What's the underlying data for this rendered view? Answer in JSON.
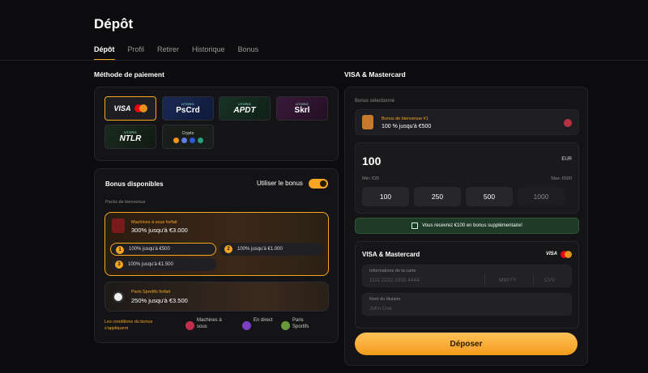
{
  "title": "Dépôt",
  "tabs": [
    "Dépôt",
    "Profil",
    "Retirer",
    "Historique",
    "Bonus"
  ],
  "payment": {
    "label": "Méthode de paiement",
    "methods": [
      {
        "name": "VISA",
        "sub": ""
      },
      {
        "name": "PsCrd",
        "sub": "UTORG"
      },
      {
        "name": "APDT",
        "sub": "UTORG"
      },
      {
        "name": "Skrl",
        "sub": "UTORG"
      },
      {
        "name": "NTLR",
        "sub": "UTORG"
      },
      {
        "name": "Crypto",
        "sub": ""
      }
    ]
  },
  "bonus": {
    "title": "Bonus disponibles",
    "use_label": "Utiliser le bonus",
    "packs_label": "Packs de bienvenue",
    "slot_pack": {
      "name": "Machines à sous forfait",
      "amount": "300% jusqu'à €3.000"
    },
    "slot_pills": [
      {
        "n": "1",
        "text": "100% jusqu'à €500"
      },
      {
        "n": "2",
        "text": "100% jusqu'à €1.000"
      },
      {
        "n": "3",
        "text": "100% jusqu'à €1.500"
      }
    ],
    "sport_pack": {
      "name": "Paris Sportifs forfait",
      "amount": "250% jusqu'à €3.500"
    },
    "conditions": "Les conditions du bonus s'appliquent",
    "tags": [
      "Machines à sous",
      "En direct",
      "Paris Sportifs"
    ]
  },
  "right": {
    "label": "VISA & Mastercard",
    "selected_label": "Bonus sélectionné",
    "selected_name": "Bonus de bienvenue #1",
    "selected_amount": "100 % jusqu'à €500",
    "amount": "100",
    "currency": "EUR",
    "min": "Min: €20",
    "max": "Max: €500",
    "quick": [
      "100",
      "250",
      "500",
      "1000"
    ],
    "notice": "Vous recevrez €100 en bonus supplémentaire!",
    "card_section": "VISA & Mastercard",
    "card_info_label": "Informations de la carte",
    "card_placeholder": "1111 2222 3333 4444",
    "exp_placeholder": "MM/YY",
    "cvv_placeholder": "CVV",
    "holder_label": "Nom du titulaire",
    "holder_placeholder": "John Doe",
    "visa_logo": "VISA",
    "deposit": "Déposer"
  },
  "colors": {
    "accent": "#f5a623",
    "panel": "#141416",
    "notice_bg": "#1f3a26"
  }
}
